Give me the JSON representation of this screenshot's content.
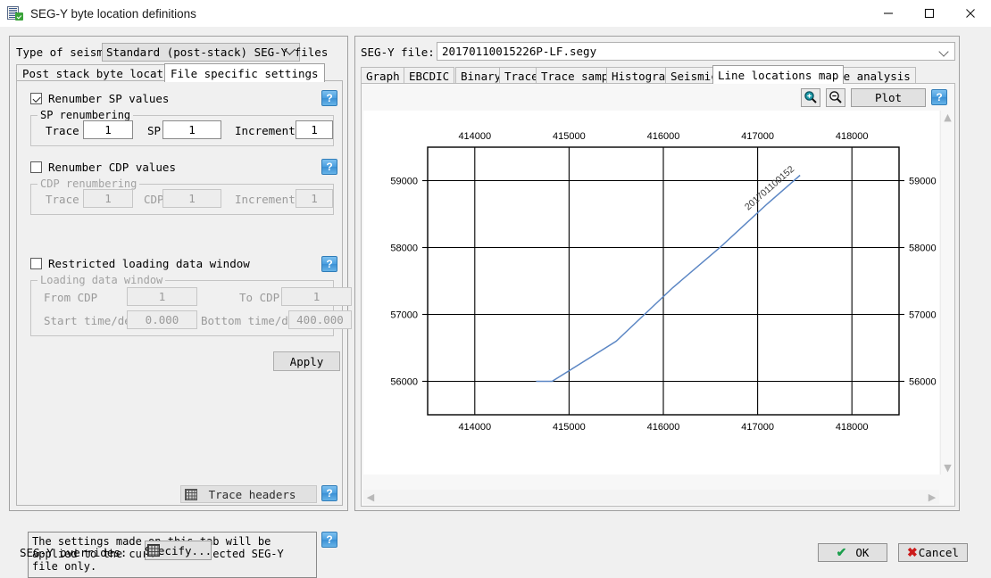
{
  "window": {
    "title": "SEG-Y byte location definitions",
    "icon": "segy-document-icon",
    "minimize": "minimize-icon",
    "maximize": "maximize-icon",
    "close": "close-icon"
  },
  "left_panel": {
    "type_label": "Type of seismic",
    "type_value": "Standard (post-stack) SEG-Y files",
    "tabs": [
      {
        "label": "Post stack byte locations",
        "active": false
      },
      {
        "label": "File specific settings",
        "active": true
      }
    ],
    "renumber_sp": {
      "checkbox_label": "Renumber SP values",
      "checked": true,
      "group_legend": "SP renumbering",
      "trace_label": "Trace",
      "trace_value": "1",
      "sp_label": "SP",
      "sp_value": "1",
      "increment_label": "Increment",
      "increment_value": "1"
    },
    "renumber_cdp": {
      "checkbox_label": "Renumber CDP values",
      "checked": false,
      "group_legend": "CDP renumbering",
      "trace_label": "Trace",
      "trace_value": "1",
      "cdp_label": "CDP",
      "cdp_value": "1",
      "increment_label": "Increment",
      "increment_value": "1"
    },
    "restricted": {
      "checkbox_label": "Restricted loading data window",
      "checked": false,
      "group_legend": "Loading data window",
      "from_cdp_label": "From CDP",
      "from_cdp_value": "1",
      "to_cdp_label": "To CDP",
      "to_cdp_value": "1",
      "start_label": "Start time/depth",
      "start_value": "0.000",
      "bottom_label": "Bottom time/depth",
      "bottom_value": "400.000"
    },
    "apply_label": "Apply",
    "trace_headers_label": "Trace headers",
    "info_text": "The settings made on this tab will be applied to the currently selected SEG-Y file only.",
    "help_label": "?"
  },
  "right_panel": {
    "file_label": "SEG-Y file:",
    "file_value": "20170110015226P-LF.segy",
    "tabs": [
      {
        "label": "Graph",
        "active": false
      },
      {
        "label": "EBCDIC",
        "active": false
      },
      {
        "label": "Binary",
        "active": false
      },
      {
        "label": "Trace",
        "active": false
      },
      {
        "label": "Trace samples",
        "active": false
      },
      {
        "label": "Histogram",
        "active": false
      },
      {
        "label": "Seismic",
        "active": false
      },
      {
        "label": "Line locations map",
        "active": true
      },
      {
        "label": "File analysis",
        "active": false
      }
    ],
    "zoom_in_icon": "zoom-in-icon",
    "zoom_out_icon": "zoom-out-icon",
    "plot_label": "Plot",
    "help_label": "?"
  },
  "footer": {
    "overrides_label": "SEG-Y overrides:",
    "specify_label": "Specify...",
    "ok_label": "OK",
    "cancel_label": "Cancel"
  },
  "chart_data": {
    "type": "line",
    "title": "",
    "xlabel": "",
    "ylabel": "",
    "xlim": [
      413500,
      418500
    ],
    "ylim": [
      55500,
      59500
    ],
    "xticks": [
      414000,
      415000,
      416000,
      417000,
      418000
    ],
    "yticks": [
      56000,
      57000,
      58000,
      59000
    ],
    "xticklabels": [
      "414000",
      "415000",
      "416000",
      "417000",
      "418000"
    ],
    "yticklabels": [
      "56000",
      "57000",
      "58000",
      "59000"
    ],
    "grid": true,
    "axis_labels_top": true,
    "axis_labels_right": true,
    "line_color": "#5b86c4",
    "series": [
      {
        "name": "201701100152",
        "annotation": "201701100152",
        "x": [
          414650,
          414820,
          415500,
          416100,
          416600,
          417100,
          417450
        ],
        "y": [
          56000,
          56000,
          56600,
          57400,
          58000,
          58650,
          59080
        ]
      }
    ]
  }
}
